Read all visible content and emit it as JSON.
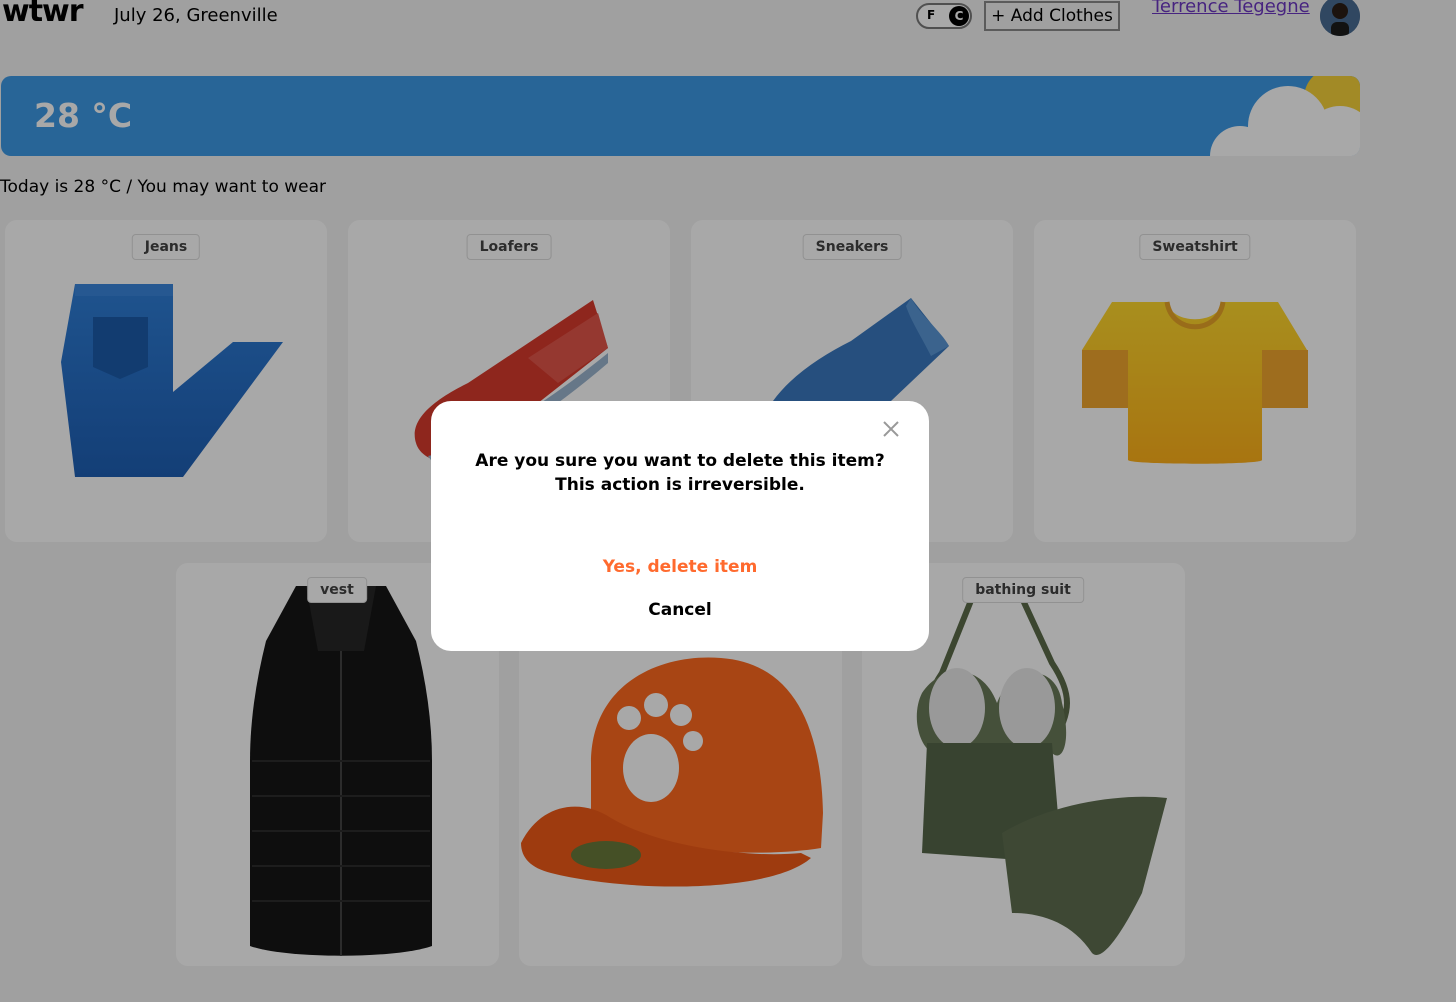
{
  "header": {
    "logo": "wtwr",
    "logo_mark": "°",
    "date_location": "July 26, Greenville",
    "toggle": {
      "off_label": "F",
      "on_label": "C",
      "selected": "C"
    },
    "add_clothes_label": "+ Add Clothes",
    "user_name": "Terrence Tegegne"
  },
  "weather": {
    "temperature": "28 °C",
    "condition_icon": "sun-behind-cloud-icon",
    "banner_color": "#3e99e6"
  },
  "suggestion_text": "Today is 28 °C / You may want to wear",
  "items": [
    {
      "name": "Jeans",
      "icon": "jeans-icon"
    },
    {
      "name": "Loafers",
      "icon": "loafers-icon"
    },
    {
      "name": "Sneakers",
      "icon": "sneakers-icon"
    },
    {
      "name": "Sweatshirt",
      "icon": "sweatshirt-icon"
    },
    {
      "name": "vest",
      "icon": "vest-image"
    },
    {
      "name": "",
      "icon": "cap-image"
    },
    {
      "name": "bathing suit",
      "icon": "bathing-suit-image"
    }
  ],
  "modal": {
    "message": "Are you sure you want to delete this item? This action is irreversible.",
    "confirm_label": "Yes, delete item",
    "cancel_label": "Cancel",
    "confirm_color": "#ff6a2e"
  }
}
